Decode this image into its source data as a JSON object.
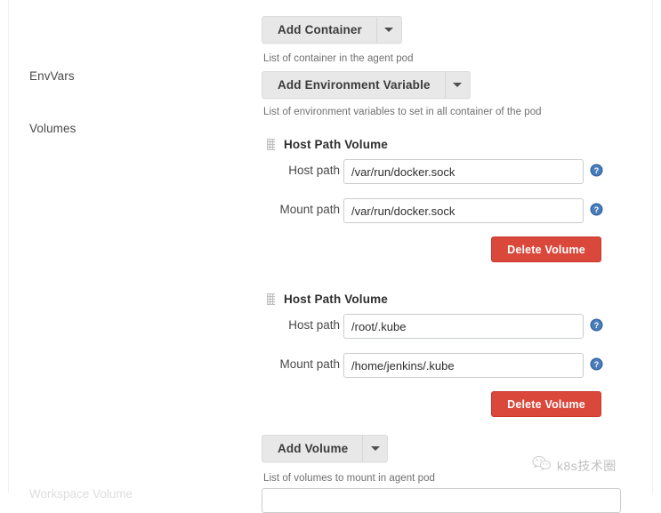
{
  "form": {
    "labels": {
      "envvars": "EnvVars",
      "volumes": "Volumes",
      "truncated_bottom": "Workspace Volume"
    }
  },
  "toolbar": {
    "add_container": {
      "label": "Add Container",
      "caret_icon": "chevron-down-icon",
      "helper_text": "List of container in the agent pod"
    },
    "add_environment_variable": {
      "label": "Add Environment Variable",
      "caret_icon": "chevron-down-icon",
      "helper_text": "List of environment variables to set in all container of the pod"
    },
    "add_volume": {
      "label": "Add Volume",
      "caret_icon": "chevron-down-icon",
      "helper_text": "List of volumes to mount in agent pod"
    }
  },
  "volumes": [
    {
      "title": "Host Path Volume",
      "drag_handle_icon": "drag-handle-icon",
      "host_path": {
        "label": "Host path",
        "value": "/var/run/docker.sock",
        "placeholder": "",
        "help_icon": "help-circle-icon"
      },
      "mount_path": {
        "label": "Mount path",
        "value": "/var/run/docker.sock",
        "placeholder": "",
        "help_icon": "help-circle-icon"
      },
      "delete_label": "Delete Volume"
    },
    {
      "title": "Host Path Volume",
      "drag_handle_icon": "drag-handle-icon",
      "host_path": {
        "label": "Host path",
        "value": "/root/.kube",
        "placeholder": "",
        "help_icon": "help-circle-icon"
      },
      "mount_path": {
        "label": "Mount path",
        "value": "/home/jenkins/.kube",
        "placeholder": "",
        "help_icon": "help-circle-icon"
      },
      "delete_label": "Delete Volume"
    }
  ],
  "watermark": {
    "text": "k8s技术圈",
    "icon": "wechat-logo-icon"
  },
  "colors": {
    "button_face": "#e8e8e8",
    "danger": "#d9483b",
    "help_icon_blue": "#3465a4",
    "input_border": "#c9ccd0",
    "text": "#333333",
    "helper_text": "#6f6f6f"
  }
}
